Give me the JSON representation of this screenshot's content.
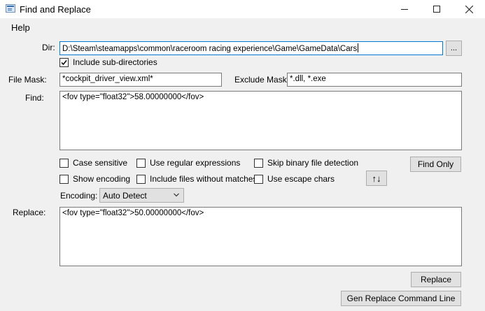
{
  "window": {
    "title": "Find and Replace"
  },
  "menu": {
    "help": "Help"
  },
  "dir": {
    "label": "Dir:",
    "value": "D:\\Steam\\steamapps\\common\\raceroom racing experience\\Game\\GameData\\Cars",
    "browse_label": "...",
    "include_subdirs_label": "Include sub-directories",
    "include_subdirs_checked": true
  },
  "file_mask": {
    "label": "File Mask:",
    "value": "*cockpit_driver_view.xml*"
  },
  "exclude_mask": {
    "label": "Exclude Mask:",
    "value": "*.dll, *.exe"
  },
  "find": {
    "label": "Find:",
    "value": "<fov type=\"float32\">58.00000000</fov>"
  },
  "options": {
    "case_sensitive": "Case sensitive",
    "use_regex": "Use regular expressions",
    "skip_binary": "Skip binary file detection",
    "show_encoding": "Show encoding",
    "include_no_match": "Include files without matches",
    "use_escape": "Use escape chars"
  },
  "buttons": {
    "find_only": "Find Only",
    "swap": "↑↓",
    "replace": "Replace",
    "gen_cmd": "Gen Replace Command Line"
  },
  "encoding": {
    "label": "Encoding:",
    "value": "Auto Detect"
  },
  "replace": {
    "label": "Replace:",
    "value": "<fov type=\"float32\">50.00000000</fov>"
  },
  "icons": {
    "app": "find-replace-app-icon",
    "minimize": "minimize-icon",
    "maximize": "maximize-icon",
    "close": "close-icon",
    "checkmark": "checkmark-icon",
    "dropdown": "chevron-down-icon"
  }
}
